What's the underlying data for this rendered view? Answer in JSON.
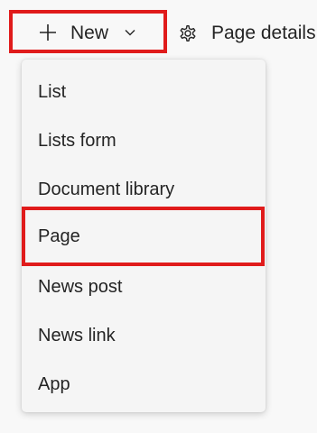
{
  "toolbar": {
    "new_button": {
      "label": "New",
      "icon": "plus-icon",
      "dropdown_icon": "chevron-down-icon"
    },
    "page_details": {
      "label": "Page details",
      "icon": "gear-icon"
    }
  },
  "menu": {
    "items": [
      {
        "label": "List"
      },
      {
        "label": "Lists form"
      },
      {
        "label": "Document library"
      },
      {
        "label": "Page",
        "highlighted": true
      },
      {
        "label": "News post"
      },
      {
        "label": "News link"
      },
      {
        "label": "App"
      }
    ]
  },
  "colors": {
    "highlight_border": "#e01b1b",
    "background": "#f8f8f8",
    "menu_background": "#f5f5f5",
    "text": "#242424"
  }
}
